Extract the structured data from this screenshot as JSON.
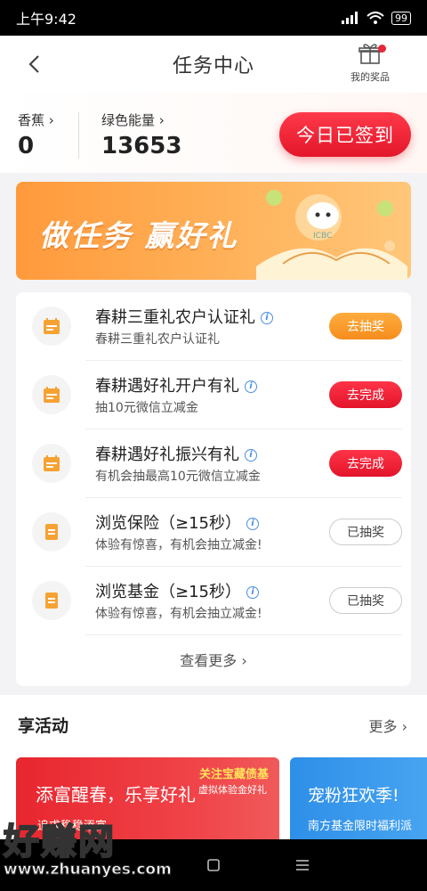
{
  "status": {
    "time": "上午9:42",
    "battery": "99"
  },
  "header": {
    "title": "任务中心",
    "prize_label": "我的奖品"
  },
  "stats": [
    {
      "label": "香蕉",
      "value": "0"
    },
    {
      "label": "绿色能量",
      "value": "13653"
    }
  ],
  "checkin_label": "今日已签到",
  "banner": {
    "text": "做任务 赢好礼",
    "badge": "ICBC"
  },
  "tasks": [
    {
      "title": "春耕三重礼农户认证礼",
      "sub": "春耕三重礼农户认证礼",
      "button": "去抽奖",
      "style": "orange",
      "icon": "calendar-icon"
    },
    {
      "title": "春耕遇好礼开户有礼",
      "sub": "抽10元微信立减金",
      "button": "去完成",
      "style": "red",
      "icon": "calendar-icon"
    },
    {
      "title": "春耕遇好礼振兴有礼",
      "sub": "有机会抽最高10元微信立减金",
      "button": "去完成",
      "style": "red",
      "icon": "calendar-icon"
    },
    {
      "title": "浏览保险（≥15秒）",
      "sub": "体验有惊喜，有机会抽立减金!",
      "button": "已抽奖",
      "style": "done",
      "icon": "document-icon"
    },
    {
      "title": "浏览基金（≥15秒）",
      "sub": "体验有惊喜，有机会抽立减金!",
      "button": "已抽奖",
      "style": "done",
      "icon": "document-icon"
    }
  ],
  "more_label": "查看更多",
  "activities": {
    "title": "享活动",
    "more": "更多",
    "cards": [
      {
        "title": "添富醒春，乐享好礼",
        "sub": "追求稳稳添富",
        "tag": "关注宝藏债基",
        "tag2": "虚拟体验金好礼"
      },
      {
        "title": "宠粉狂欢季!",
        "sub": "南方基金限时福利派"
      }
    ]
  },
  "watermark": {
    "main": "好赚网",
    "url": "www.zhuanyes.com"
  },
  "colors": {
    "accent_red": "#e3162a",
    "accent_orange": "#f58d1c",
    "blue": "#4a8fe0"
  }
}
